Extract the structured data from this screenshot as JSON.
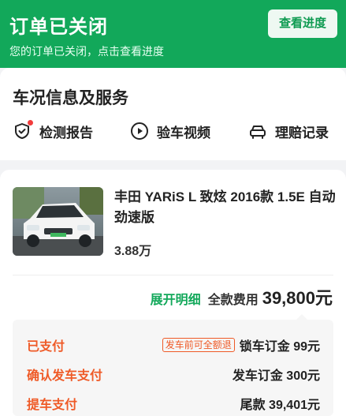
{
  "header": {
    "title": "订单已关闭",
    "subtitle": "您的订单已关闭，点击查看进度",
    "progress_button": "查看进度",
    "bg_color": "#12a85a"
  },
  "services": {
    "title": "车况信息及服务",
    "items": [
      {
        "label": "检测报告",
        "icon": "inspection-report-icon"
      },
      {
        "label": "验车视频",
        "icon": "play-video-icon"
      },
      {
        "label": "理赔记录",
        "icon": "car-claim-icon"
      }
    ]
  },
  "car": {
    "name": "丰田 YARiS L 致炫 2016款 1.5E 自动劲速版",
    "mileage": "3.88万",
    "thumbnail": "white-car-photo"
  },
  "cost": {
    "expand_link": "展开明细",
    "total_label": "全款费用",
    "total_value": "39,800元"
  },
  "payments": [
    {
      "status": "已支付",
      "tag": "发车前可全额退",
      "label": "锁车订金 99元"
    },
    {
      "status": "确认发车支付",
      "tag": "",
      "label": "发车订金 300元"
    },
    {
      "status": "提车支付",
      "tag": "",
      "label": "尾款 39,401元"
    }
  ],
  "colors": {
    "accent": "#12a85a",
    "payment_status": "#ef5a27"
  }
}
